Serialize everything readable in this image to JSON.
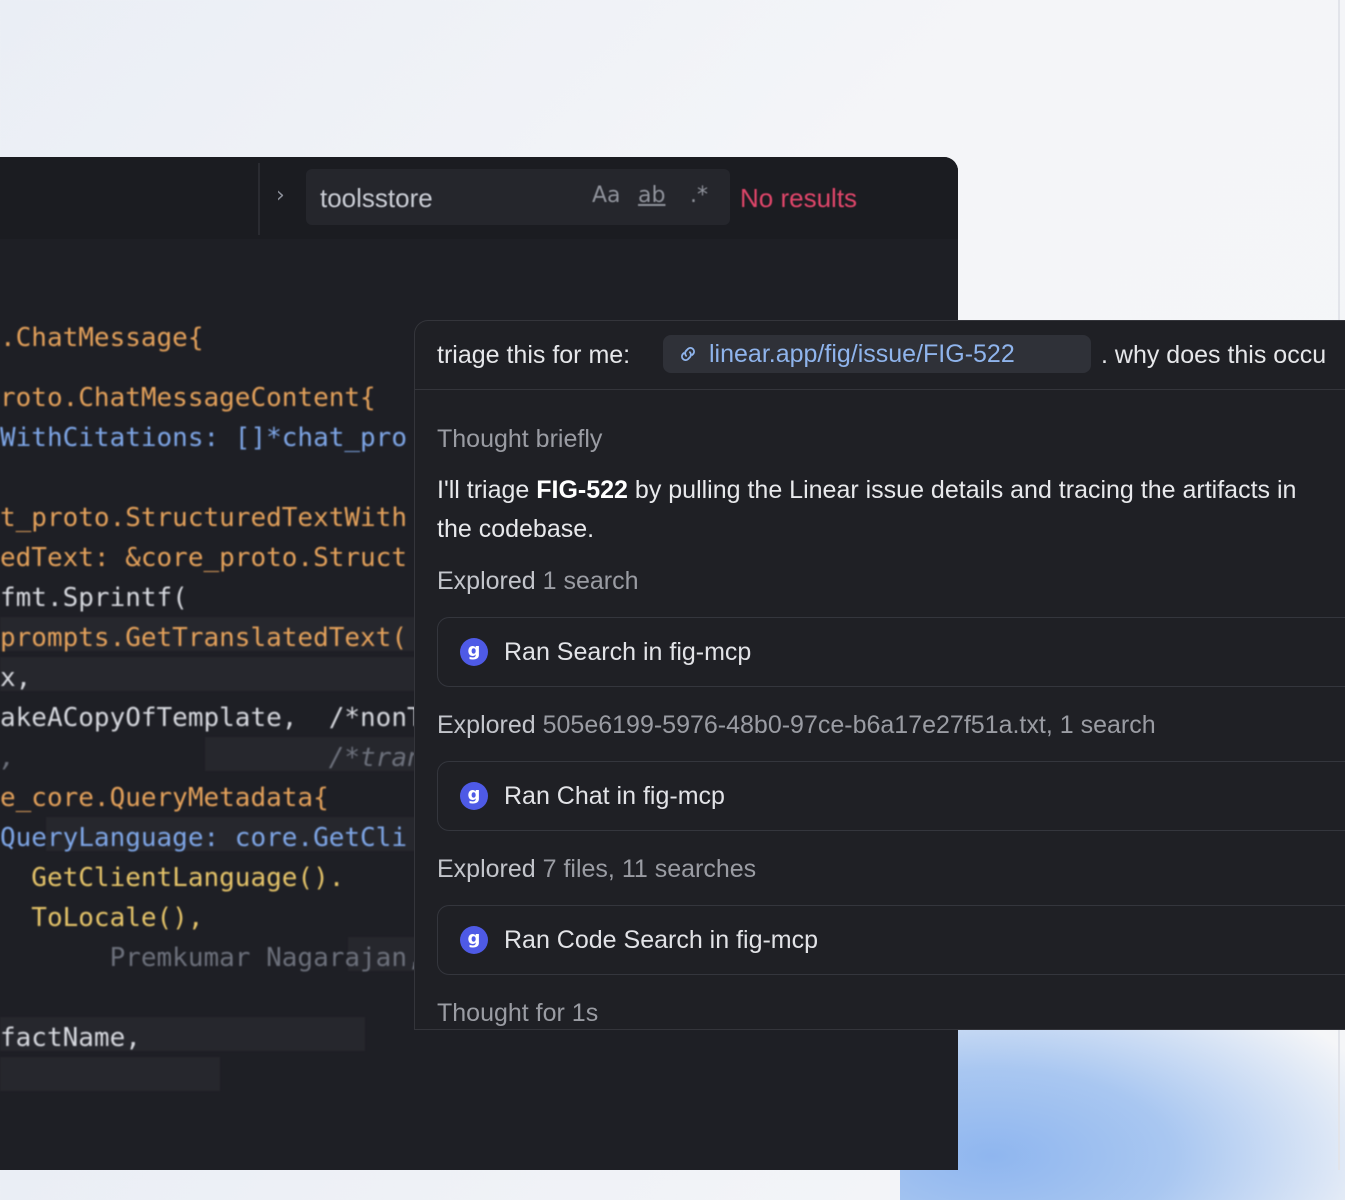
{
  "find_bar": {
    "query": "toolsstore",
    "option_case": "Aa",
    "option_word": "ab",
    "option_regex": ".*",
    "status": "No results"
  },
  "code_lines": [
    ".ChatMessage{",
    "roto.ChatMessageContent{",
    "WithCitations: []*chat_pro",
    "t_proto.StructuredTextWith",
    "edText: &core_proto.Struct",
    "fmt.Sprintf(",
    "prompts.GetTranslatedText(",
    "x,",
    "akeACopyOfTemplate,  /*nonT",
    ",                    /*tran",
    "e_core.QueryMetadata{",
    "QueryLanguage: core.GetCli",
    "  GetClientLanguage().",
    "  ToLocale(),",
    "       Premkumar Nagarajan,",
    "factName,"
  ],
  "chat": {
    "prompt_lead": "triage this for me:",
    "prompt_link": "linear.app/fig/issue/FIG-522",
    "prompt_tail": ". why does this occu",
    "thought_1": "Thought briefly",
    "message_pre": "I'll triage ",
    "message_bold": "FIG-522",
    "message_post": " by pulling the Linear issue details and tracing the artifacts in the codebase.",
    "explored_1_label": "Explored",
    "explored_1_detail": "1 search",
    "tool_1": "Ran Search in fig-mcp",
    "explored_2_label": "Explored",
    "explored_2_detail": "505e6199-5976-48b0-97ce-b6a17e27f51a.txt, 1 search",
    "tool_2": "Ran Chat in fig-mcp",
    "explored_3_label": "Explored",
    "explored_3_detail": "7 files, 11 searches",
    "tool_3": "Ran Code Search in fig-mcp",
    "thought_2": "Thought for 1s",
    "tool_badge_glyph": "g"
  },
  "colors": {
    "accent_link": "#8fb4ec",
    "error": "#e0466a",
    "tool_badge": "#4e5ae6"
  },
  "icons": [
    "chevron-right-icon",
    "link-icon",
    "mcp-server-icon"
  ]
}
